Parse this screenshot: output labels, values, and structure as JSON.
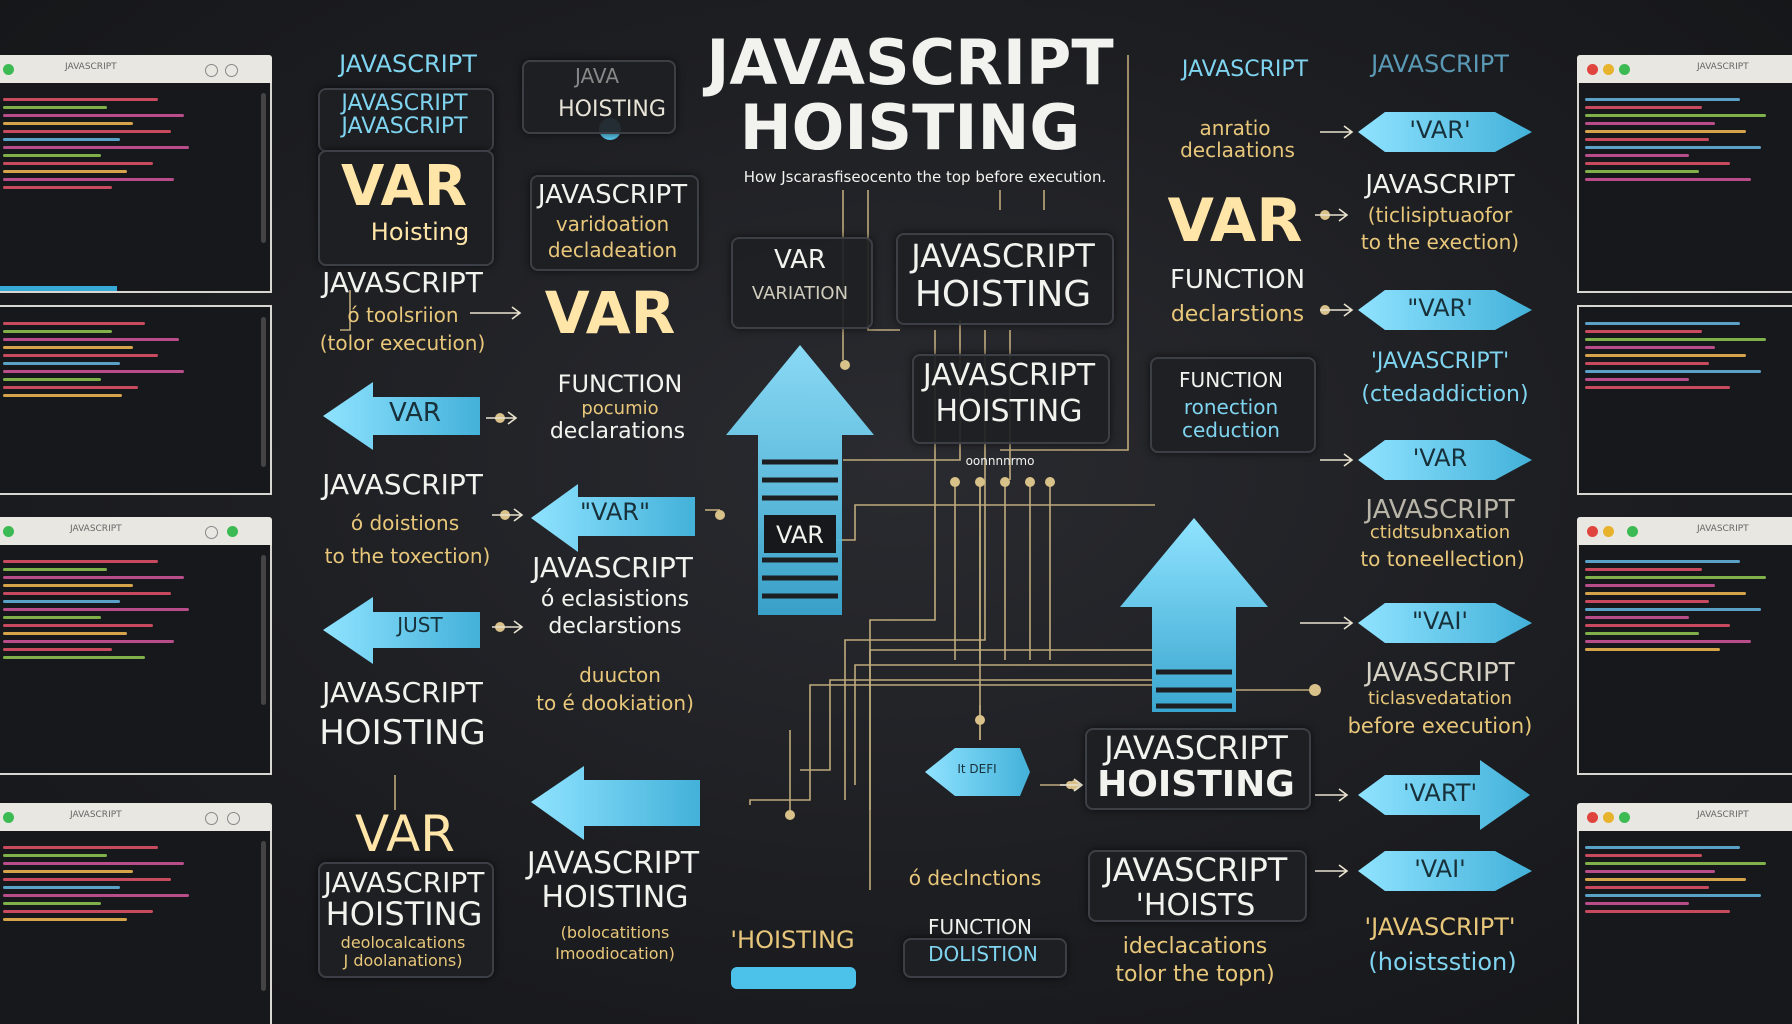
{
  "title": {
    "line1": "JAVASCRIPT",
    "line2": "HOISTING"
  },
  "subtitle": "How Jscarasfiseocento the top before execution.",
  "windows": {
    "left": [
      {
        "title": "JAVASCRIPT"
      },
      {
        "title": ""
      },
      {
        "title": "JAVASCRIPT"
      },
      {
        "title": "JAVASCRIPT"
      }
    ],
    "right": [
      {
        "title": "JAVASCRIPT"
      },
      {
        "title": ""
      },
      {
        "title": "JAVASCRIPT"
      },
      {
        "title": "JAVASCRIPT"
      }
    ]
  },
  "labels": {
    "l_js1": "JAVASCRIPT",
    "l_js2a": "JAVASCRIPT",
    "l_js2b": "JAVASCRIPT",
    "l_var1": "VAR",
    "l_hoisting1": "Hoisting",
    "l_js3": "JAVASCRIPT",
    "l_tool1": "ó toolsriion",
    "l_tool2": "(tolor execution)",
    "l_js4": "JAVASCRIPT",
    "l_dois": "ó doistions",
    "l_toexec": "to the toxection)",
    "l_js5": "JAVASCRIPT",
    "l_hoist5": "HOISTING",
    "l_var2": "VAR",
    "l_js6": "JAVASCRIPT",
    "l_hoist6": "HOISTING",
    "l_decl6a": "deolocalcations",
    "l_decl6b": "J doolanations)",
    "c2_java": "JAVA",
    "c2_hoisting": "HOISTING",
    "c2_js1": "JAVASCRIPT",
    "c2_vd1": "varidoation",
    "c2_vd2": "decladeation",
    "c2_var": "VAR",
    "c2_func": "FUNCTION",
    "c2_funcsub": "pocumio",
    "c2_decl": "declarations",
    "c2_js2": "JAVASCRIPT",
    "c2_decl2a": "ó eclasistions",
    "c2_decl2b": "declarstions",
    "c2_fn3a": "duucton",
    "c2_fn3b": "to é dookiation)",
    "c2_js3": "JAVASCRIPT",
    "c2_hoist3": "HOISTING",
    "c2_decl3a": "(bolocatitions",
    "c2_decl3b": "Imoodiocation)",
    "c3_var": "VAR",
    "c3_variation": "VARIATION",
    "c3_js": "JAVASCRIPT",
    "c3_hoist": "HOISTING",
    "c3_js2": "JAVASCRIPT",
    "c3_hoist2": "HOISTING",
    "c3_var_arrow": "VAR",
    "c3_small": "oonnnnrmo",
    "c3_arrow_small": "It DEFI",
    "c3_decl": "ó declnctions",
    "c3_hoisting_q": "'HOISTING",
    "c3_func": "FUNCTION",
    "c3_func_sub": "DOLISTION",
    "c4_js": "JAVASCRIPT",
    "c4_hoist": "HOISTING",
    "c4_js2": "JAVASCRIPT",
    "c4_hoists": "'HOISTS",
    "c4_decl": "ideclacations",
    "c4_top": "tolor the topn)",
    "r_js1": "JAVASCRIPT",
    "r_decl_a": "anratio",
    "r_decl_b": "declaations",
    "r_var": "VAR",
    "r_func": "FUNCTION",
    "r_decl2": "declarstions",
    "r_func2a": "FUNCTION",
    "r_func2b": "ronection",
    "r_func2c": "ceduction",
    "r2_js0": "JAVASCRIPT",
    "r2_js1": "JAVASCRIPT",
    "r2_js1b": "(ticlisiptuaofor",
    "r2_js1c": "to the exection)",
    "r2_js2": "'JAVASCRIPT'",
    "r2_js2b": "(ctedaddiction)",
    "r2_js3": "JAVASCRIPT",
    "r2_js3b": "ctidtsubnxation",
    "r2_js3c": "to toneellection)",
    "r2_js4": "JAVASCRIPT",
    "r2_js4b": "ticlasvedatation",
    "r2_js4c": "before execution)",
    "r2_js5": "'JAVASCRIPT'",
    "r2_js5b": "(hoistsstion)"
  },
  "arrows": {
    "left_var1": "VAR",
    "left_var2": "\"VAR\"",
    "left_var3": "JUST",
    "right_var1": "'VAR'",
    "right_var2": "\"VAR'",
    "right_var3": "'VAR",
    "right_var4": "\"VAI'",
    "right_var5": "'VART'",
    "right_var6": "'VAI'"
  },
  "colors": {
    "background": "#1d1e22",
    "accent": "#6fd0ef",
    "wire": "#d9c28a",
    "text": "#f2f2ee",
    "gold": "#e8c77a"
  }
}
